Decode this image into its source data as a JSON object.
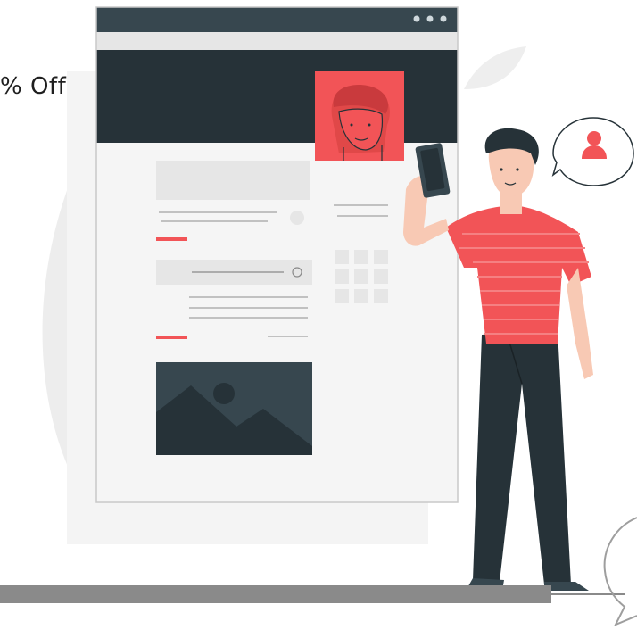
{
  "promo": {
    "text": "% Off"
  },
  "colors": {
    "accent": "#f25457",
    "dark": "#263238",
    "panel": "#f5f5f5",
    "placeholder": "#e6e6e6",
    "browser_bar": "#e0e0e0",
    "leaf": "#ebebeb",
    "ground": "#8a8a8a"
  },
  "icons": [
    "browser-dots-icon",
    "profile-photo-icon",
    "user-icon",
    "image-placeholder-icon",
    "mountain-icon",
    "sun-icon",
    "smartphone-icon",
    "speech-bubble-icon",
    "leaf-icon"
  ]
}
